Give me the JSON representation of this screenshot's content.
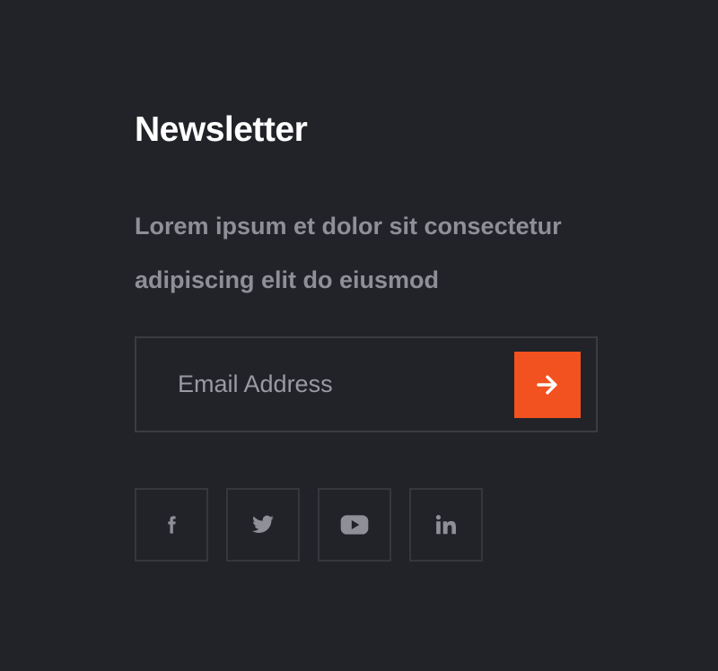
{
  "newsletter": {
    "title": "Newsletter",
    "description": "Lorem ipsum et dolor sit consectetur adipiscing elit do eiusmod",
    "email_placeholder": "Email Address",
    "submit_icon": "arrow-right-icon"
  },
  "social_links": [
    {
      "name": "facebook",
      "icon": "facebook-icon"
    },
    {
      "name": "twitter",
      "icon": "twitter-icon"
    },
    {
      "name": "youtube",
      "icon": "youtube-icon"
    },
    {
      "name": "linkedin",
      "icon": "linkedin-icon"
    }
  ],
  "colors": {
    "background": "#222328",
    "accent": "#f2521f",
    "title": "#ffffff",
    "muted_text": "#8f9097",
    "border": "#3b3c42"
  }
}
